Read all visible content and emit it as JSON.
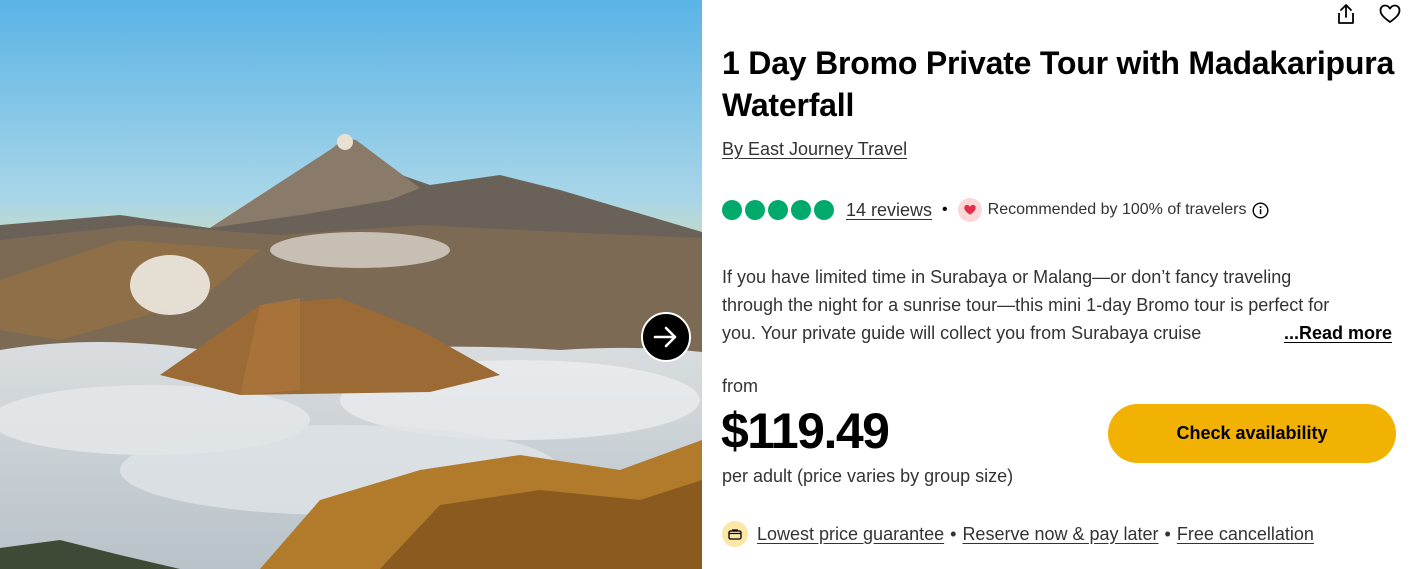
{
  "tour": {
    "title": "1 Day Bromo Private Tour with Madakaripura Waterfall",
    "operator": "By East Journey Travel"
  },
  "rating": {
    "bubbles": 5,
    "bubble_color": "#00aa6c",
    "reviews_label": "14 reviews",
    "separator": "•",
    "recommended": "Recommended by 100% of travelers"
  },
  "description": {
    "line1": "If you have limited time in Surabaya or Malang—or don’t fancy traveling",
    "line2": "through the night for a sunrise tour—this mini 1-day Bromo tour is perfect for",
    "line3": "you. Your private guide will collect you from Surabaya cruise",
    "read_more": "...Read more"
  },
  "pricing": {
    "from_label": "from",
    "price": "$119.49",
    "per_label": "per adult (price varies by group size)"
  },
  "cta": {
    "label": "Check availability",
    "color": "#f2b203"
  },
  "benefits": {
    "items": [
      "Lowest price guarantee",
      "Reserve now & pay later",
      "Free cancellation"
    ],
    "separator": "•"
  },
  "icons": {
    "share": "share-icon",
    "save": "heart-outline-icon",
    "next": "arrow-right-icon",
    "info": "info-icon",
    "recommend": "heart-icon",
    "price_tag": "price-tag-icon"
  }
}
